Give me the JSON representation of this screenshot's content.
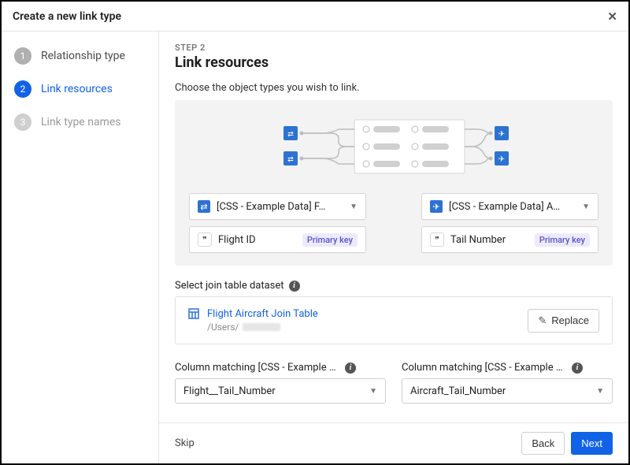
{
  "header": {
    "title": "Create a new link type"
  },
  "sidebar": {
    "items": [
      {
        "num": "1",
        "label": "Relationship type",
        "state": "done"
      },
      {
        "num": "2",
        "label": "Link resources",
        "state": "active"
      },
      {
        "num": "3",
        "label": "Link type names",
        "state": "upcoming"
      }
    ]
  },
  "main": {
    "step_label": "STEP 2",
    "heading": "Link resources",
    "intro": "Choose the object types you wish to link.",
    "left_type": {
      "label": "[CSS - Example Data] F…",
      "key_field": "Flight ID",
      "key_chip": "Primary key"
    },
    "right_type": {
      "label": "[CSS - Example Data] A…",
      "key_field": "Tail Number",
      "key_chip": "Primary key"
    },
    "join_section_label": "Select join table dataset",
    "dataset": {
      "name": "Flight Aircraft Join Table",
      "path_prefix": "/Users/",
      "replace_label": "Replace"
    },
    "col_left_label": "Column matching [CSS - Example Data] …",
    "col_right_label": "Column matching [CSS - Example Data] …",
    "col_left_value": "Flight__Tail_Number",
    "col_right_value": "Aircraft_Tail_Number"
  },
  "footer": {
    "skip": "Skip",
    "back": "Back",
    "next": "Next"
  }
}
